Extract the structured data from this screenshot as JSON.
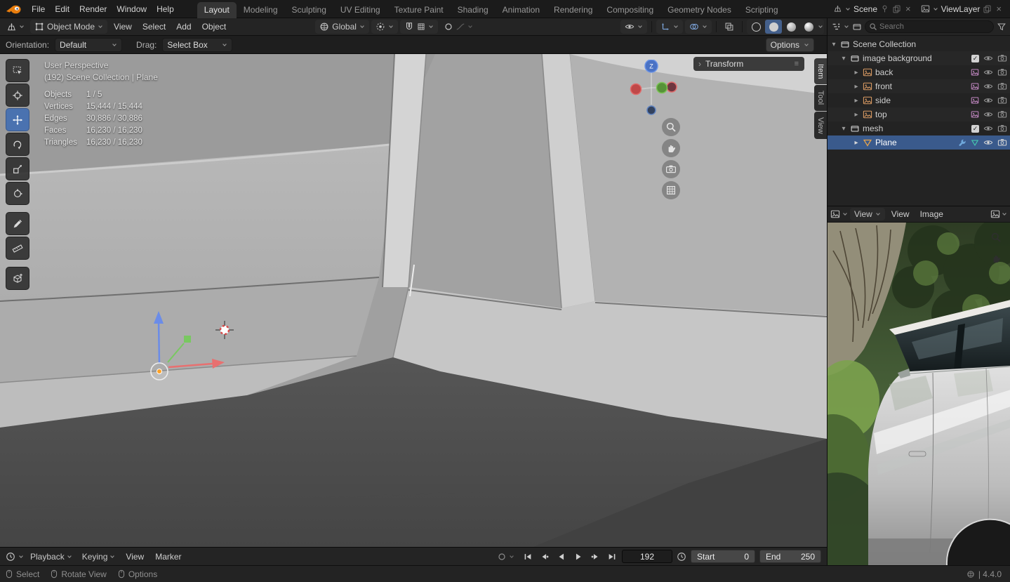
{
  "topbar": {
    "menus": [
      "File",
      "Edit",
      "Render",
      "Window",
      "Help"
    ],
    "tabs": [
      "Layout",
      "Modeling",
      "Sculpting",
      "UV Editing",
      "Texture Paint",
      "Shading",
      "Animation",
      "Rendering",
      "Compositing",
      "Geometry Nodes",
      "Scripting"
    ],
    "active_tab": "Layout",
    "scene_label": "Scene",
    "view_layer_label": "ViewLayer"
  },
  "viewport_header": {
    "mode_label": "Object Mode",
    "menus": [
      "View",
      "Select",
      "Add",
      "Object"
    ],
    "orientation_label": "Global"
  },
  "tool_settings": {
    "orientation_label": "Orientation:",
    "orientation_value": "Default",
    "drag_label": "Drag:",
    "drag_value": "Select Box",
    "options_label": "Options"
  },
  "viewport": {
    "view_name": "User Perspective",
    "context_line": "(192) Scene Collection | Plane",
    "stats": [
      {
        "label": "Objects",
        "value": "1 / 5"
      },
      {
        "label": "Vertices",
        "value": "15,444 / 15,444"
      },
      {
        "label": "Edges",
        "value": "30,886 / 30,886"
      },
      {
        "label": "Faces",
        "value": "16,230 / 16,230"
      },
      {
        "label": "Triangles",
        "value": "16,230 / 16,230"
      }
    ],
    "transform_panel_label": "Transform",
    "sidebar_tabs": [
      "Item",
      "Tool",
      "View"
    ],
    "nav_z_label": "Z"
  },
  "outliner": {
    "search_placeholder": "Search",
    "rows": [
      {
        "label": "Scene Collection"
      },
      {
        "label": "image background"
      },
      {
        "label": "back"
      },
      {
        "label": "front"
      },
      {
        "label": "side"
      },
      {
        "label": "top"
      },
      {
        "label": "mesh"
      },
      {
        "label": "Plane"
      }
    ]
  },
  "image_editor": {
    "mode_label": "View",
    "menus": [
      "View",
      "Image"
    ]
  },
  "timeline": {
    "playback_label": "Playback",
    "keying_label": "Keying",
    "menus": [
      "View",
      "Marker"
    ],
    "current_frame": "192",
    "start_label": "Start",
    "start_value": "0",
    "end_label": "End",
    "end_value": "250"
  },
  "status_bar": {
    "hints": [
      "Select",
      "Rotate View",
      "Options"
    ],
    "version": "| 4.4.0"
  }
}
